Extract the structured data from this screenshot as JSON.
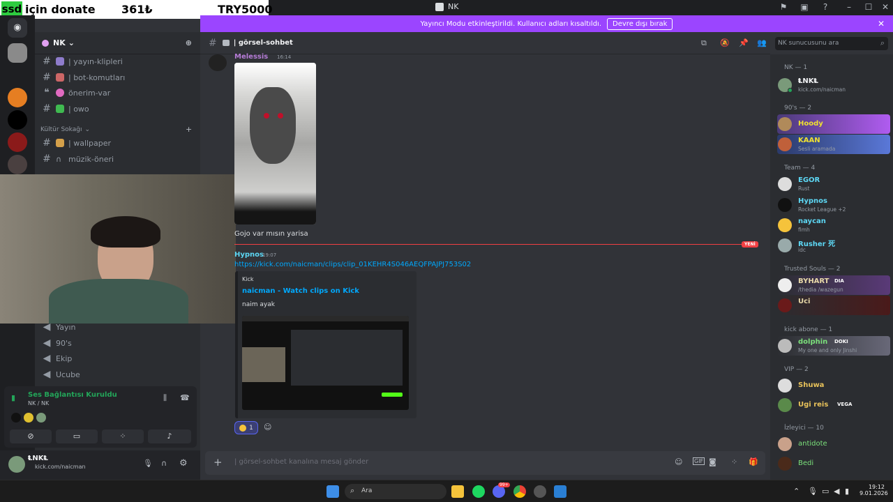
{
  "window": {
    "title": "NK"
  },
  "donate": {
    "ssd": "ssd",
    "text": "için donate",
    "amount": "361₺",
    "goal": "TRY5000"
  },
  "banner": {
    "text": "Yayıncı Modu etkinleştirildi. Kullanıcı adları kısaltıldı.",
    "button": "Devre dışı bırak"
  },
  "server": {
    "name": "NK"
  },
  "channels": {
    "top": [
      {
        "label": "| yayın-klipleri"
      },
      {
        "label": "| bot-komutları"
      },
      {
        "label": "önerim-var"
      },
      {
        "label": "| owo"
      }
    ],
    "category": "Kültür Sokağı",
    "cat_items": [
      {
        "label": "| wallpaper"
      },
      {
        "label": "müzik-öneri"
      },
      {
        "label": "oyun"
      }
    ],
    "voice": [
      {
        "label": "Yayın"
      },
      {
        "label": "90's"
      },
      {
        "label": "Ekip"
      },
      {
        "label": "Ucube"
      }
    ]
  },
  "voice_status": {
    "title": "Ses Bağlantısı Kuruldu",
    "sub": "NK / NK"
  },
  "user": {
    "name": "ⱠNKⱠ",
    "status": "kick.com/naicman"
  },
  "chat": {
    "channel": "| görsel-sohbet",
    "search_placeholder": "NK sunucusunu ara",
    "msg1": {
      "author": "Melessis",
      "time": "16:14"
    },
    "line": "Gojo var mısın yarisa",
    "new_label": "YENİ",
    "msg2": {
      "author": "Hypnos",
      "time": "19:07",
      "link": "https://kick.com/naicman/clips/clip_01KEHR4S046AEQFPAJPJ753S02"
    },
    "embed": {
      "provider": "Kick",
      "title": "naicman - Watch clips on Kick",
      "desc": "naim ayak"
    },
    "reaction": {
      "count": "1"
    },
    "composer_placeholder": "| görsel-sohbet kanalına mesaj gönder"
  },
  "members": {
    "groups": [
      {
        "label": "NK — 1"
      },
      {
        "label": "90's — 2"
      },
      {
        "label": "Team — 4"
      },
      {
        "label": "Trusted Souls — 2"
      },
      {
        "label": "kick abone — 1"
      },
      {
        "label": "VIP — 2"
      },
      {
        "label": "İzleyici — 10"
      }
    ],
    "list": [
      {
        "name": "ⱠNKⱠ",
        "sub": "kick.com/naicman",
        "color": "#f2f3f5"
      },
      {
        "name": "Hoody",
        "sub": "",
        "color": "#f0e130"
      },
      {
        "name": "KAAN",
        "sub": "Sesli aramada",
        "color": "#f0e130"
      },
      {
        "name": "EGOR",
        "sub": "Rust",
        "color": "#5dd8f5"
      },
      {
        "name": "Hypnos",
        "sub": "Rocket League +2",
        "color": "#5dd8f5"
      },
      {
        "name": "naycan",
        "sub": "fimh",
        "color": "#5dd8f5"
      },
      {
        "name": "Rusher 死",
        "sub": "idc",
        "color": "#5dd8f5"
      },
      {
        "name": "BYHART",
        "sub": "/thedia /wazegun",
        "color": "#e8d8a8",
        "tag": "DIA"
      },
      {
        "name": "Uci",
        "sub": "",
        "color": "#e8d8a8"
      },
      {
        "name": "dolphin",
        "sub": "My one and only Jinshi",
        "color": "#7be07b",
        "tag": "DOKI"
      },
      {
        "name": "Shuwa",
        "sub": "",
        "color": "#e8c25a"
      },
      {
        "name": "Ugi reis",
        "sub": "",
        "color": "#e8c25a",
        "tag": "VEGA"
      },
      {
        "name": "antidote",
        "sub": "",
        "color": "#7be07b"
      },
      {
        "name": "Bedi",
        "sub": "",
        "color": "#7be07b"
      }
    ]
  },
  "taskbar": {
    "search": "Ara",
    "time": "19:12",
    "date": "9.01.2026",
    "discord_badge": "99+"
  },
  "colors": {
    "accent": "#5865f2",
    "banner": "#9b45ff",
    "new": "#f23f43"
  }
}
